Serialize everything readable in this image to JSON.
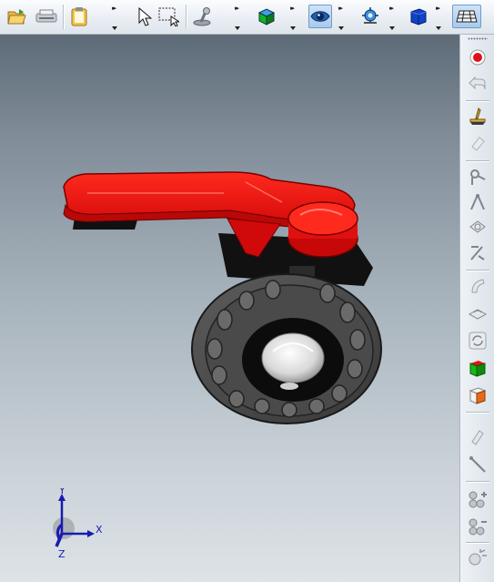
{
  "toolbar": {
    "groups": [
      {
        "name": "file",
        "icons": [
          "open-folder-icon",
          "print-icon",
          "clipboard-icon"
        ]
      },
      {
        "name": "select",
        "icons": [
          "pointer-icon",
          "window-select-icon",
          "joystick-icon"
        ]
      },
      {
        "name": "view-style",
        "icons": [
          "shaded-box-icon"
        ]
      },
      {
        "name": "camera",
        "icons": [
          "eye-view-icon"
        ]
      },
      {
        "name": "zoom",
        "icons": [
          "zoom-target-icon"
        ]
      },
      {
        "name": "solid",
        "icons": [
          "blue-cube-icon"
        ]
      },
      {
        "name": "grid",
        "icons": [
          "grid-plane-icon"
        ]
      }
    ]
  },
  "viewport": {
    "background_top": "#5d6a77",
    "background_bottom": "#dde3e7",
    "model": {
      "handle_color": "#e00c0c",
      "body_color": "#454545",
      "disc_color": "#e8e8e8"
    }
  },
  "triad": {
    "y_label": "Y",
    "x_label": "X",
    "z_label": "Z",
    "axis_color": "#1a1ab0"
  },
  "sidebar": {
    "icons": [
      "record-icon",
      "undo-icon",
      "paint-brush-icon",
      "eraser-icon",
      "pipe-valve-icon",
      "compass-icon",
      "section-plane-icon",
      "dimension-icon",
      "curve-icon",
      "surface-icon",
      "refresh-icon",
      "green-cube-icon",
      "orange-cube-icon",
      "clip-plane-icon",
      "measure-line-icon",
      "assembly-add-icon",
      "assembly-remove-icon",
      "explode-icon"
    ]
  }
}
